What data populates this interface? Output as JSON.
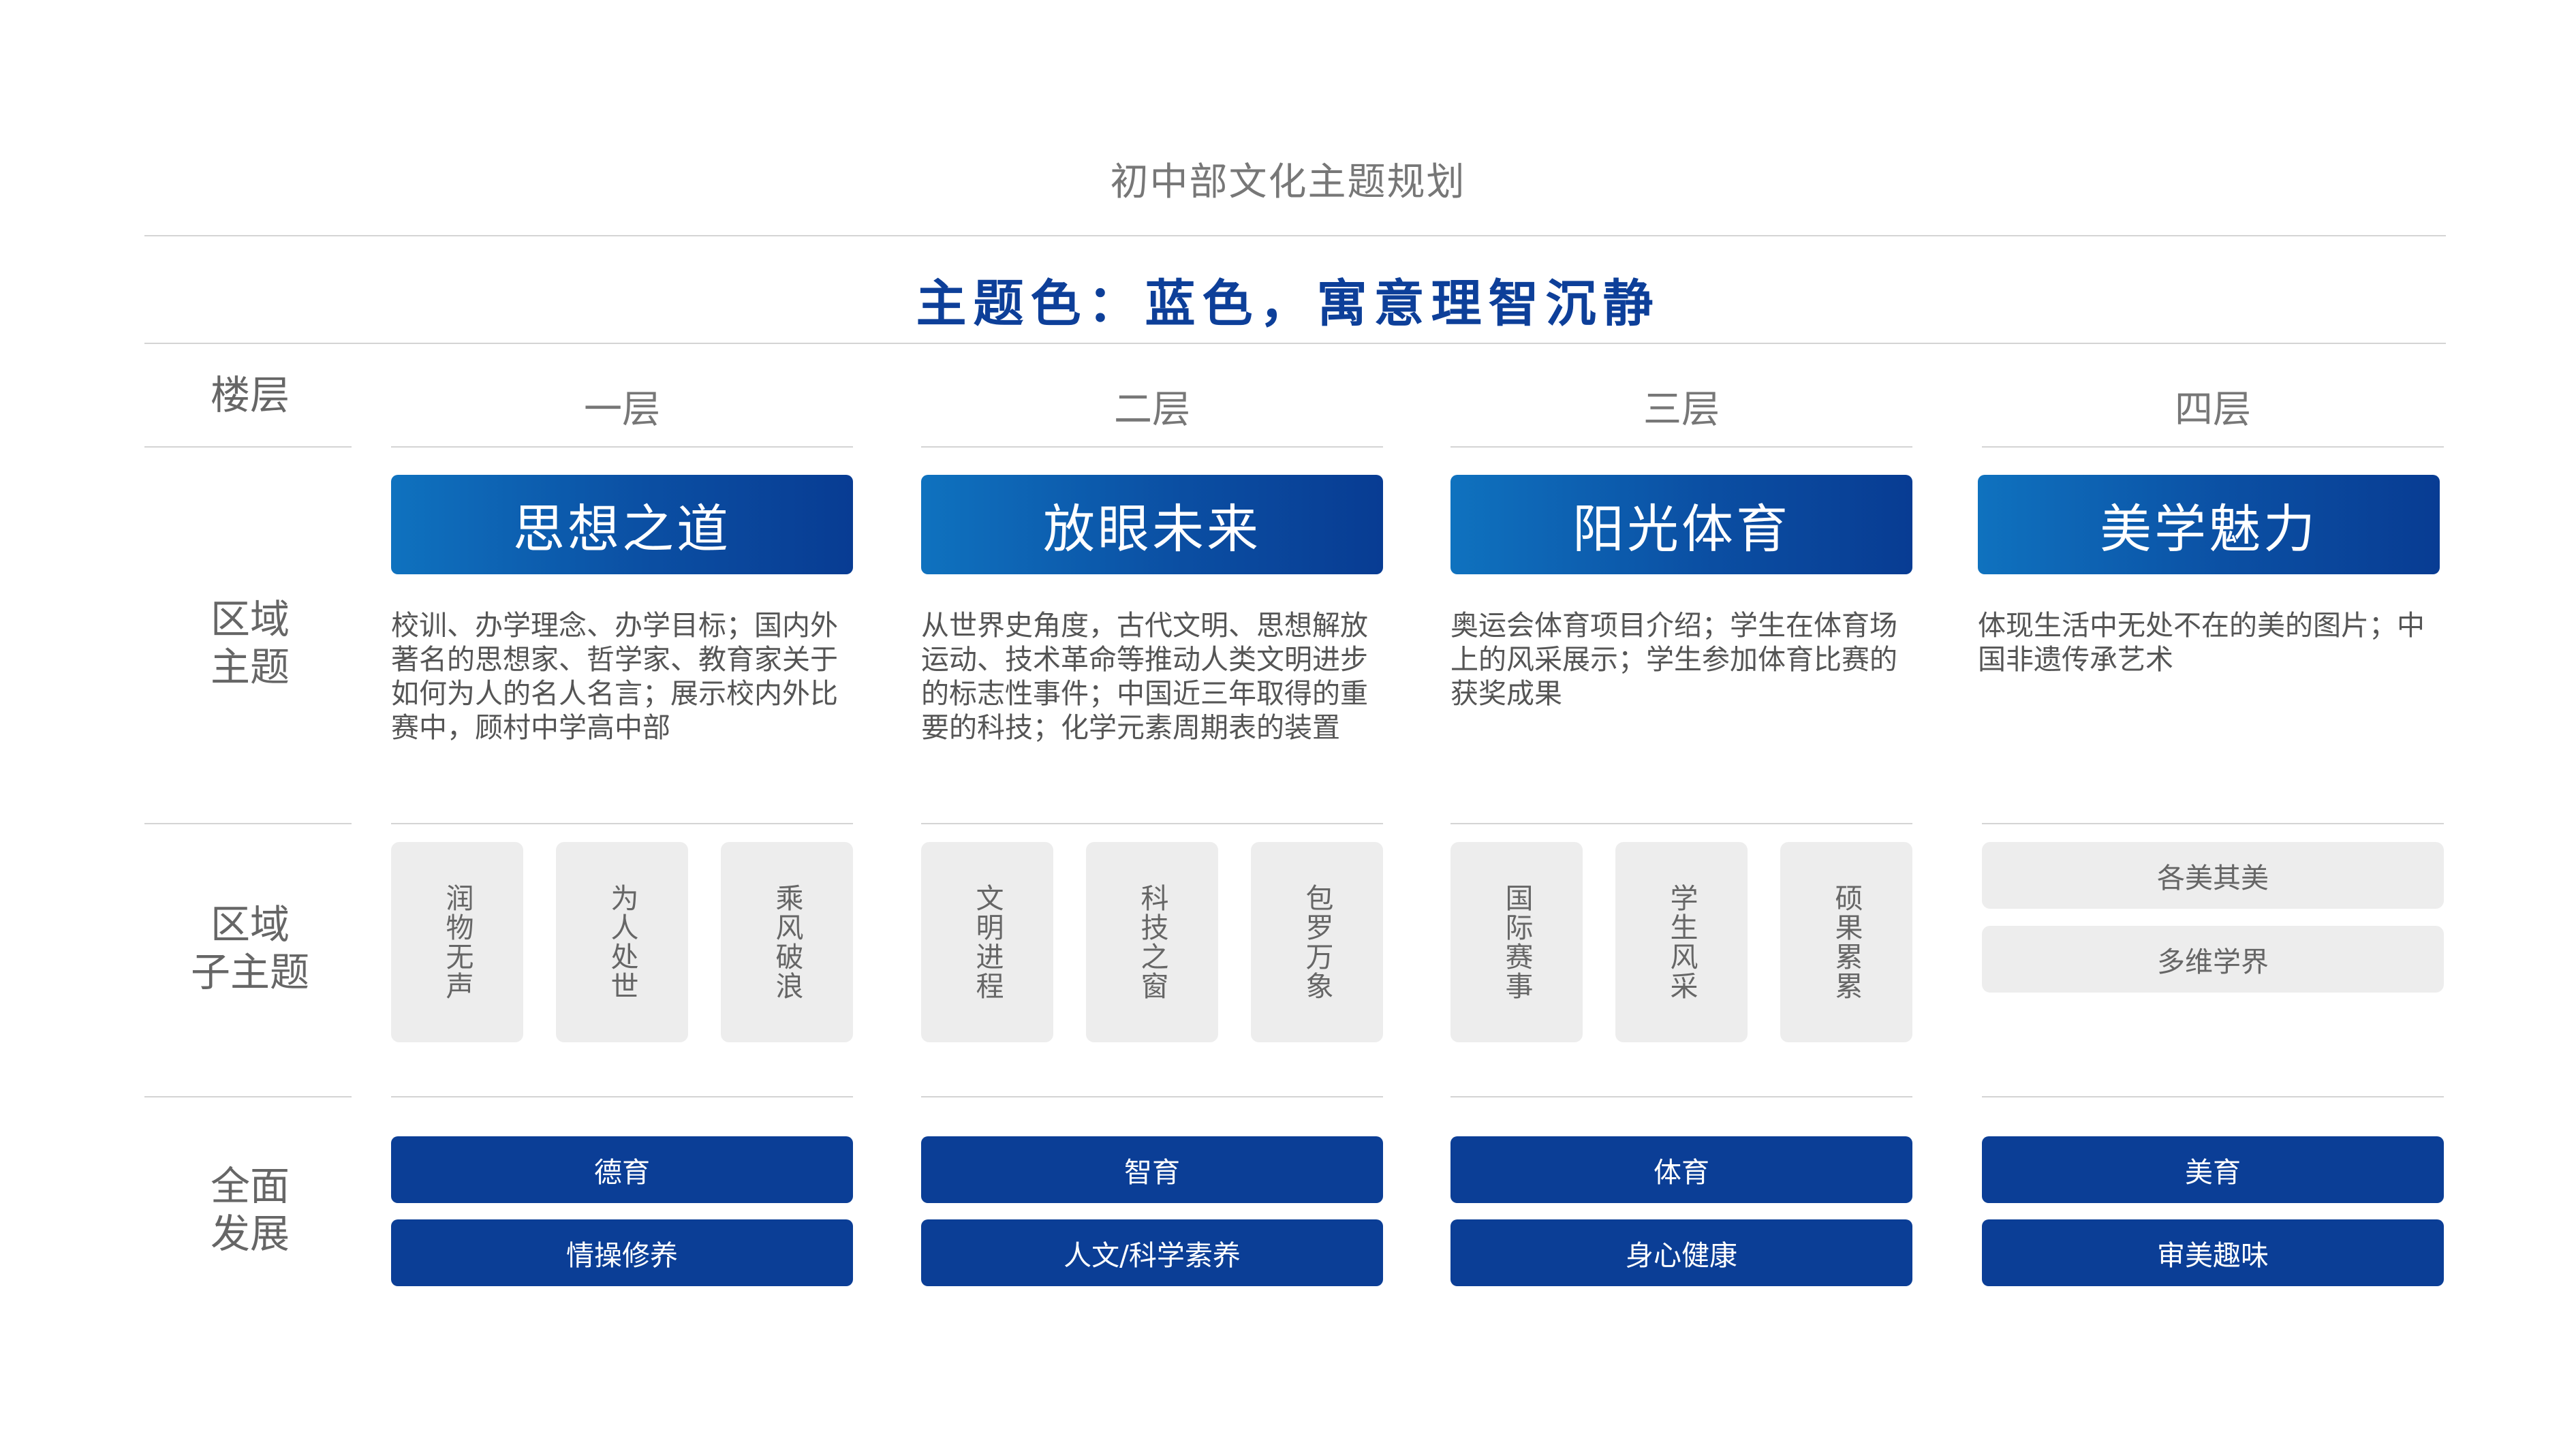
{
  "page_title": "初中部文化主题规划",
  "theme_banner": "主题色：蓝色，寓意理智沉静",
  "row_labels": {
    "floor": "楼层",
    "zone_theme": [
      "区域",
      "主题"
    ],
    "sub_theme": [
      "区域",
      "子主题"
    ],
    "development": [
      "全面",
      "发展"
    ]
  },
  "floors": [
    {
      "label": "一层",
      "zone_title": "思想之道",
      "description": "校训、办学理念、办学目标；国内外著名的思想家、哲学家、教育家关于如何为人的名人名言；展示校内外比赛中，顾村中学高中部",
      "sub_themes": [
        "润物无声",
        "为人处世",
        "乘风破浪"
      ],
      "development": [
        "德育",
        "情操修养"
      ]
    },
    {
      "label": "二层",
      "zone_title": "放眼未来",
      "description": "从世界史角度，古代文明、思想解放运动、技术革命等推动人类文明进步的标志性事件；中国近三年取得的重要的科技；化学元素周期表的装置",
      "sub_themes": [
        "文明进程",
        "科技之窗",
        "包罗万象"
      ],
      "development": [
        "智育",
        "人文/科学素养"
      ]
    },
    {
      "label": "三层",
      "zone_title": "阳光体育",
      "description": "奥运会体育项目介绍；学生在体育场上的风采展示；学生参加体育比赛的获奖成果",
      "sub_themes": [
        "国际赛事",
        "学生风采",
        "硕果累累"
      ],
      "development": [
        "体育",
        "身心健康"
      ]
    },
    {
      "label": "四层",
      "zone_title": "美学魅力",
      "description": "体现生活中无处不在的美的图片；中国非遗传承艺术",
      "sub_themes": [
        "各美其美",
        "多维学界"
      ],
      "development": [
        "美育",
        "审美趣味"
      ]
    }
  ],
  "colors": {
    "theme_blue": "#0b3e96",
    "banner_text": "#0d3f99",
    "gradient_start": "#0f72bf",
    "tile_gray": "#ededed"
  }
}
